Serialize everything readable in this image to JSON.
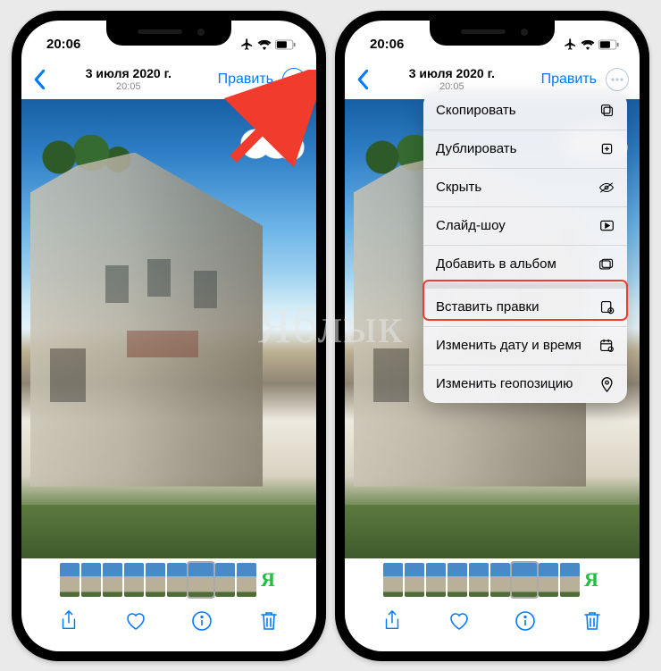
{
  "status": {
    "time": "20:06"
  },
  "nav": {
    "date": "3 июля 2020 г.",
    "time": "20:05",
    "edit_label": "Править"
  },
  "menu": {
    "items": [
      {
        "label": "Скопировать",
        "icon": "copy-icon"
      },
      {
        "label": "Дублировать",
        "icon": "duplicate-icon"
      },
      {
        "label": "Скрыть",
        "icon": "hide-icon"
      },
      {
        "label": "Слайд-шоу",
        "icon": "slideshow-icon"
      },
      {
        "label": "Добавить в альбом",
        "icon": "add-to-album-icon",
        "sep": true
      },
      {
        "label": "Вставить правки",
        "icon": "paste-edits-icon",
        "highlight": true
      },
      {
        "label": "Изменить дату и время",
        "icon": "adjust-date-icon"
      },
      {
        "label": "Изменить геопозицию",
        "icon": "adjust-location-icon"
      }
    ]
  },
  "watermark": "Яблык"
}
